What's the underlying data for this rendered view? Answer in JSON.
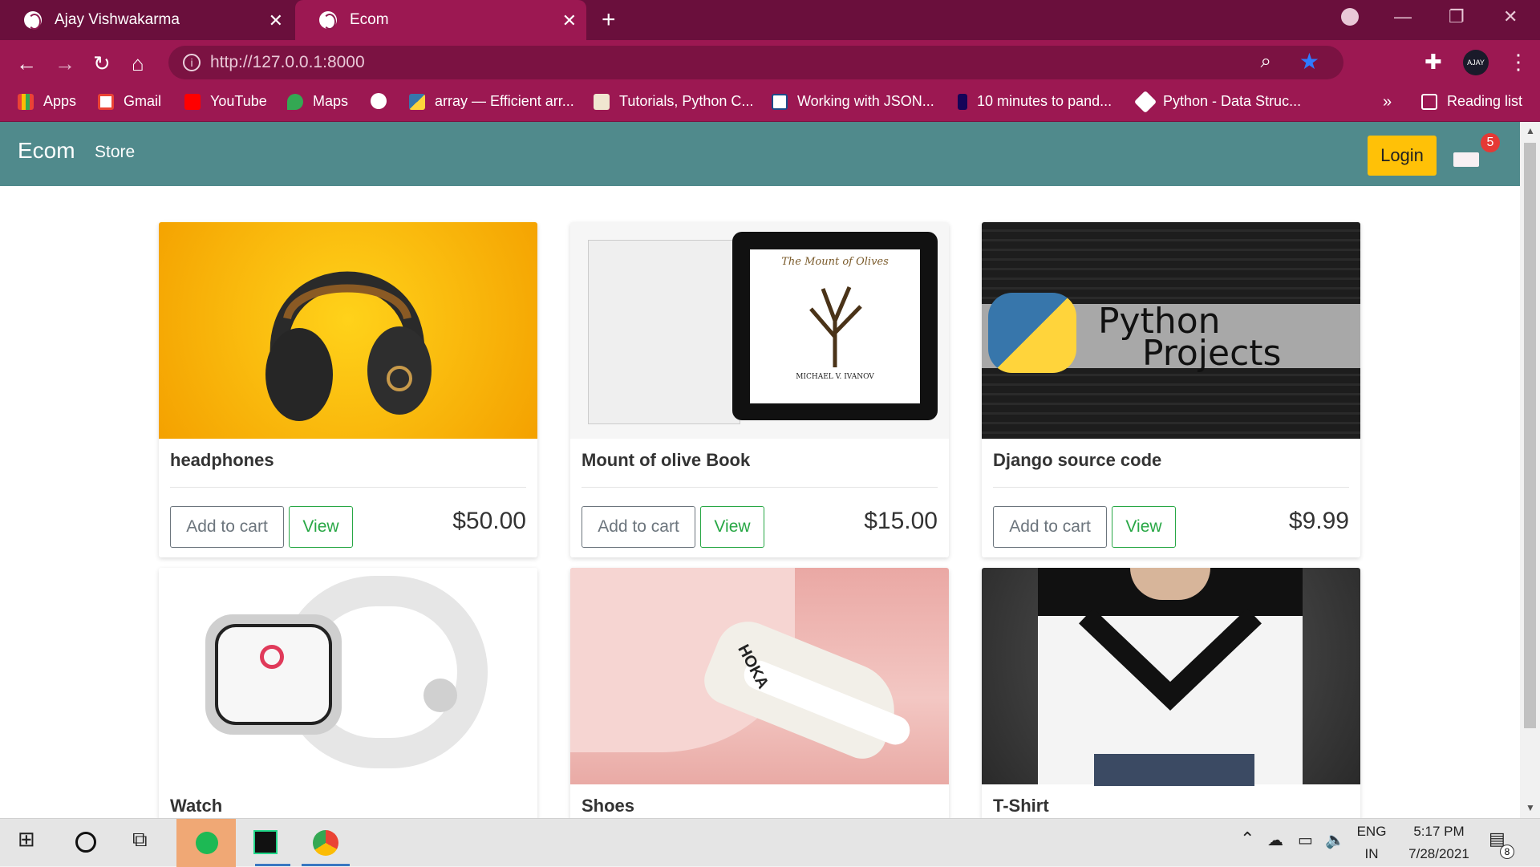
{
  "browser": {
    "tabs": [
      {
        "title": "Ajay Vishwakarma"
      },
      {
        "title": "Ecom"
      }
    ],
    "url_host": "http://127.0.0.1",
    "url_port": ":8000",
    "bookmarks": [
      {
        "label": "Apps"
      },
      {
        "label": "Gmail"
      },
      {
        "label": "YouTube"
      },
      {
        "label": "Maps"
      },
      {
        "label": ""
      },
      {
        "label": "array — Efficient arr..."
      },
      {
        "label": "Tutorials, Python C..."
      },
      {
        "label": "Working with JSON..."
      },
      {
        "label": "10 minutes to pand..."
      },
      {
        "label": "Python - Data Struc..."
      }
    ],
    "reading_list": "Reading list",
    "avatar_text": "AJAY"
  },
  "site": {
    "brand": "Ecom",
    "store": "Store",
    "login": "Login",
    "cart_count": "5"
  },
  "products": [
    {
      "name": "headphones",
      "price": "$50.00",
      "add_label": "Add to cart",
      "view_label": "View"
    },
    {
      "name": "Mount of olive Book",
      "price": "$15.00",
      "add_label": "Add to cart",
      "view_label": "View",
      "book_title": "The Mount of Olives",
      "book_author": "MICHAEL V. IVANOV"
    },
    {
      "name": "Django source code",
      "price": "$9.99",
      "add_label": "Add to cart",
      "view_label": "View",
      "banner_1": "Python",
      "banner_2": "Projects"
    },
    {
      "name": "Watch"
    },
    {
      "name": "Shoes",
      "brand_mark": "HOKA"
    },
    {
      "name": "T-Shirt"
    }
  ],
  "taskbar": {
    "lang_1": "ENG",
    "lang_2": "IN",
    "time": "5:17 PM",
    "date": "7/28/2021",
    "notif_count": "8"
  }
}
